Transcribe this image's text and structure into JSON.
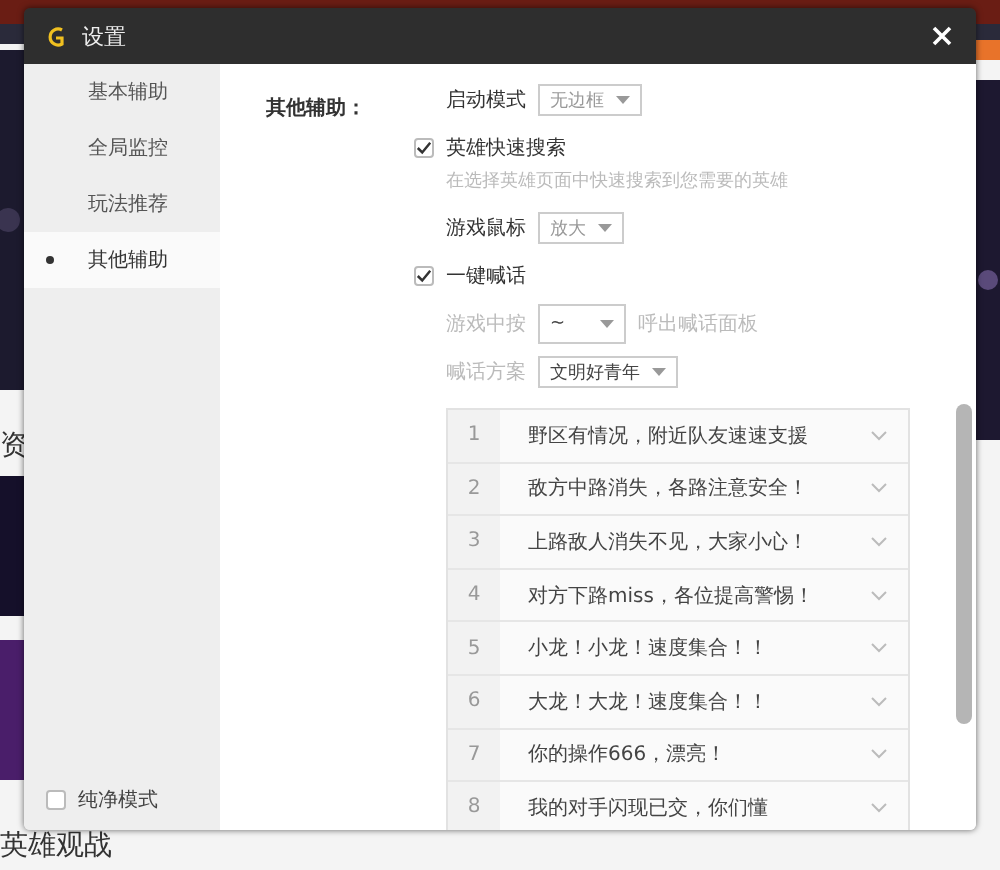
{
  "background": {
    "texts": [
      {
        "text": "资"
      },
      {
        "text": "英雄观战"
      }
    ]
  },
  "window": {
    "title": "设置"
  },
  "sidebar": {
    "items": [
      {
        "label": "基本辅助",
        "selected": false
      },
      {
        "label": "全局监控",
        "selected": false
      },
      {
        "label": "玩法推荐",
        "selected": false
      },
      {
        "label": "其他辅助",
        "selected": true
      }
    ],
    "pure_mode": {
      "label": "纯净模式",
      "checked": false
    }
  },
  "section": {
    "title": "其他辅助：",
    "rows": [
      {
        "kind": "select",
        "label": "启动模式",
        "value": "无边框",
        "disabled": false
      },
      {
        "kind": "checkbox",
        "label": "英雄快速搜索",
        "checked": true
      },
      {
        "kind": "hint",
        "text": "在选择英雄页面中快速搜索到您需要的英雄"
      },
      {
        "kind": "select",
        "label": "游戏鼠标",
        "value": "放大",
        "disabled": false
      },
      {
        "kind": "checkbox",
        "label": "一键喊话",
        "checked": true
      },
      {
        "kind": "key",
        "label": "游戏中按",
        "value": "~",
        "suffix": "呼出喊话面板",
        "disabled": true
      },
      {
        "kind": "select",
        "label": "喊话方案",
        "value": "文明好青年",
        "disabled": true
      }
    ]
  },
  "phrases": [
    {
      "number": "1",
      "text": "野区有情况，附近队友速速支援"
    },
    {
      "number": "2",
      "text": "敌方中路消失，各路注意安全！"
    },
    {
      "number": "3",
      "text": "上路敌人消失不见，大家小心！"
    },
    {
      "number": "4",
      "text": "对方下路miss，各位提高警惕！"
    },
    {
      "number": "5",
      "text": "小龙！小龙！速度集合！！"
    },
    {
      "number": "6",
      "text": "大龙！大龙！速度集合！！"
    },
    {
      "number": "7",
      "text": "你的操作666，漂亮！"
    },
    {
      "number": "8",
      "text": "我的对手闪现已交，你们懂"
    }
  ]
}
